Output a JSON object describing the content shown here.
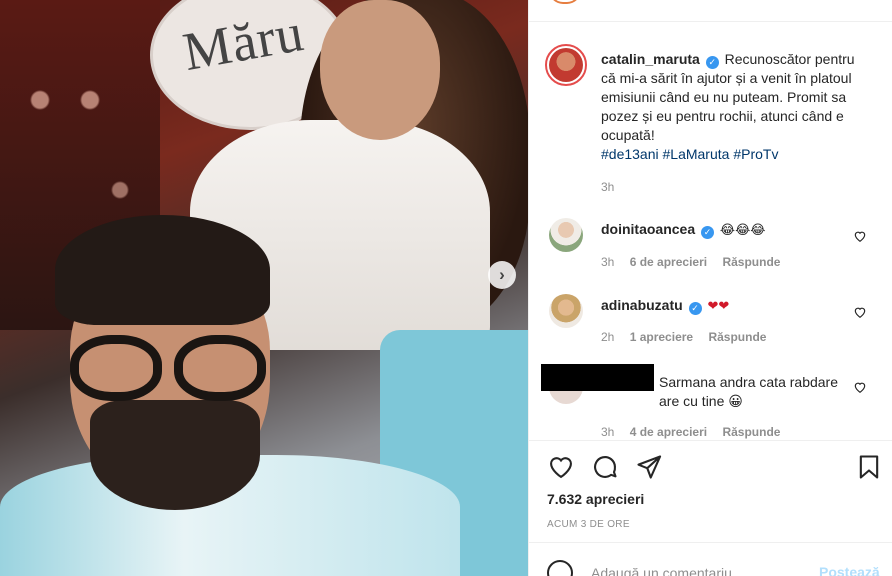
{
  "post": {
    "username": "catalin_maruta",
    "caption": "Recunoscător pentru că mi-a sărit în ajutor și a venit în platoul emisiunii când eu nu puteam. Promit sa pozez și eu pentru rochii, atunci când e ocupată!",
    "hashtags": "#de13ani #LaMaruta #ProTv",
    "time": "3h",
    "photo_sign_text": "Măru",
    "likes": "7.632 aprecieri",
    "posted_ago": "ACUM 3 DE ORE"
  },
  "comments": [
    {
      "username": "doinitaoancea",
      "text": "😂😂😂",
      "time": "3h",
      "likes": "6 de aprecieri",
      "reply": "Răspunde"
    },
    {
      "username": "adinabuzatu",
      "text": "❤❤",
      "time": "2h",
      "likes": "1 apreciere",
      "reply": "Răspunde"
    },
    {
      "username": "",
      "text": "Sarmana andra cata rabdare are cu tine 😀",
      "time": "3h",
      "likes": "4 de aprecieri",
      "reply": "Răspunde"
    }
  ],
  "comment_box": {
    "placeholder": "Adaugă un comentariu...",
    "post_label": "Postează"
  },
  "colors": {
    "verified": "#3897f0",
    "hashtag": "#00376b",
    "muted": "#8e8e8e",
    "post_disabled": "#b2dffc"
  },
  "icons": [
    "chevron-right-icon",
    "verified-badge-icon",
    "heart-icon",
    "comment-icon",
    "share-icon",
    "bookmark-icon",
    "emoji-icon"
  ]
}
